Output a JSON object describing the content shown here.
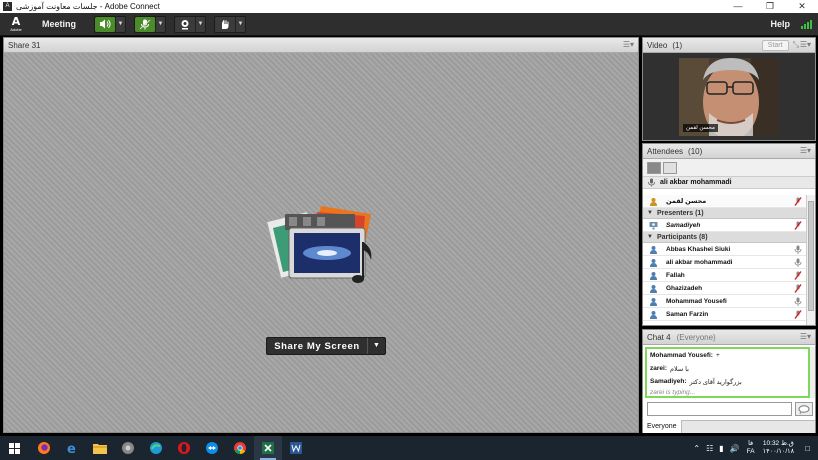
{
  "window": {
    "title": "جلسات معاونت آموزشی - Adobe Connect",
    "app_icon": "A"
  },
  "menubar": {
    "logo_mark": "A",
    "logo_text": "Adobe",
    "meeting_label": "Meeting",
    "help_label": "Help"
  },
  "share_pod": {
    "title": "Share 31",
    "button_label": "Share My Screen"
  },
  "video_pod": {
    "title": "Video",
    "count": "(1)",
    "start_label": "Start",
    "camera_name": "محسن لقمن"
  },
  "attendees_pod": {
    "title": "Attendees",
    "count": "(10)",
    "host_name": "ali akbar mohammadi",
    "hosts": [
      {
        "name": "محسن لقمن"
      }
    ],
    "presenters_label": "Presenters (1)",
    "presenters": [
      {
        "name": "Samadiyeh"
      }
    ],
    "participants_label": "Participants (8)",
    "participants": [
      {
        "name": "Abbas Khashei Siuki"
      },
      {
        "name": "ali akbar mohammadi"
      },
      {
        "name": "Fallah"
      },
      {
        "name": "Ghazizadeh"
      },
      {
        "name": "Mohammad Yousefi"
      },
      {
        "name": "Saman Farzin"
      }
    ]
  },
  "chat_pod": {
    "title": "Chat 4",
    "audience": "(Everyone)",
    "messages": [
      {
        "sender": "Mohammad Yousefi:",
        "text": "+"
      },
      {
        "sender": "zarei:",
        "text": "با سلام"
      },
      {
        "sender": "Samadiyeh:",
        "text": "بزرگوارید آقای دکتر"
      }
    ],
    "typing": "zarei is typing...",
    "tab_label": "Everyone"
  },
  "taskbar": {
    "apps": [
      "start-icon",
      "firefox-icon",
      "internet-explorer-icon",
      "file-explorer-icon",
      "chrome-legacy-icon",
      "edge-icon",
      "opera-icon",
      "teamviewer-icon",
      "chrome-icon",
      "excel-icon",
      "word-icon"
    ],
    "language": "فا",
    "language_sub": "FA",
    "time": "10:32 ق.ظ",
    "date": "۱۴۰۰/۱۰/۱۸"
  },
  "colors": {
    "accent_green": "#7dd85c",
    "toolbar_dark": "#2e2e2e",
    "taskbar": "#1b2530"
  }
}
